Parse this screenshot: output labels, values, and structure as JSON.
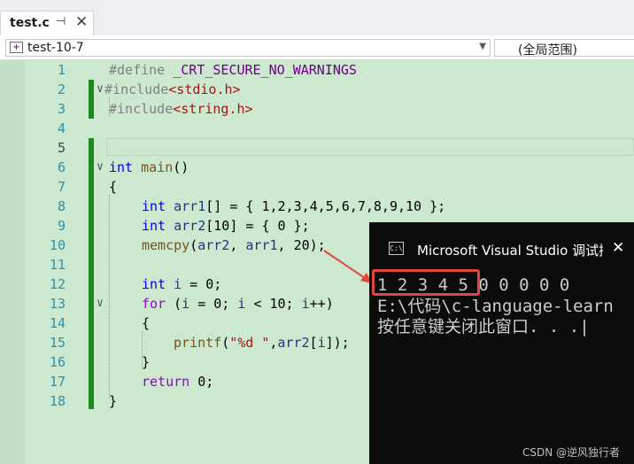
{
  "tab": {
    "title": "test.c",
    "pin_glyph": "⊣",
    "close_glyph": "✕"
  },
  "navbar": {
    "project": "test-10-7",
    "scope": "(全局范围)"
  },
  "editor": {
    "lines": [
      "1",
      "2",
      "3",
      "4",
      "5",
      "6",
      "7",
      "8",
      "9",
      "10",
      "11",
      "12",
      "13",
      "14",
      "15",
      "16",
      "17",
      "18"
    ],
    "current_line": "5",
    "code": {
      "l1a": "#define",
      "l1b": " _CRT_SECURE_NO_WARNINGS",
      "l2a": "#include",
      "l2b": "<stdio.h>",
      "l3a": "#include",
      "l3b": "<string.h>",
      "l6a": "int",
      "l6b": " ",
      "l6c": "main",
      "l6d": "()",
      "l7": "{",
      "l8a": "int",
      "l8b": " ",
      "l8c": "arr1",
      "l8d": "[] = { 1,2,3,4,5,6,7,8,9,10 };",
      "l9a": "int",
      "l9b": " ",
      "l9c": "arr2",
      "l9d": "[10] = { 0 };",
      "l10a": "memcpy",
      "l10b": "(",
      "l10c": "arr2",
      "l10d": ", ",
      "l10e": "arr1",
      "l10f": ", 20);",
      "l12a": "int",
      "l12b": " ",
      "l12c": "i",
      "l12d": " = 0;",
      "l13a": "for",
      "l13b": " (",
      "l13c": "i",
      "l13d": " = 0; ",
      "l13e": "i",
      "l13f": " < 10; ",
      "l13g": "i",
      "l13h": "++)",
      "l14": "{",
      "l15a": "printf",
      "l15b": "(",
      "l15c": "\"%d \"",
      "l15d": ",",
      "l15e": "arr2",
      "l15f": "[",
      "l15g": "i",
      "l15h": "]);",
      "l16": "}",
      "l17a": "return",
      "l17b": " 0;",
      "l18": "}"
    }
  },
  "console": {
    "title": "Microsoft Visual Studio 调试控",
    "icon_text": "C:\\",
    "close_glyph": "✕",
    "output_line1": "1 2 3 4 5 0 0 0 0 0",
    "output_line2": "E:\\代码\\c-language-learn",
    "output_line3": "按任意键关闭此窗口. . .|"
  },
  "watermark": "CSDN @逆风独行者",
  "colors": {
    "editor_bg": "#cce8cf",
    "keyword": "#0000ff",
    "highlight_box": "#e0483c"
  }
}
